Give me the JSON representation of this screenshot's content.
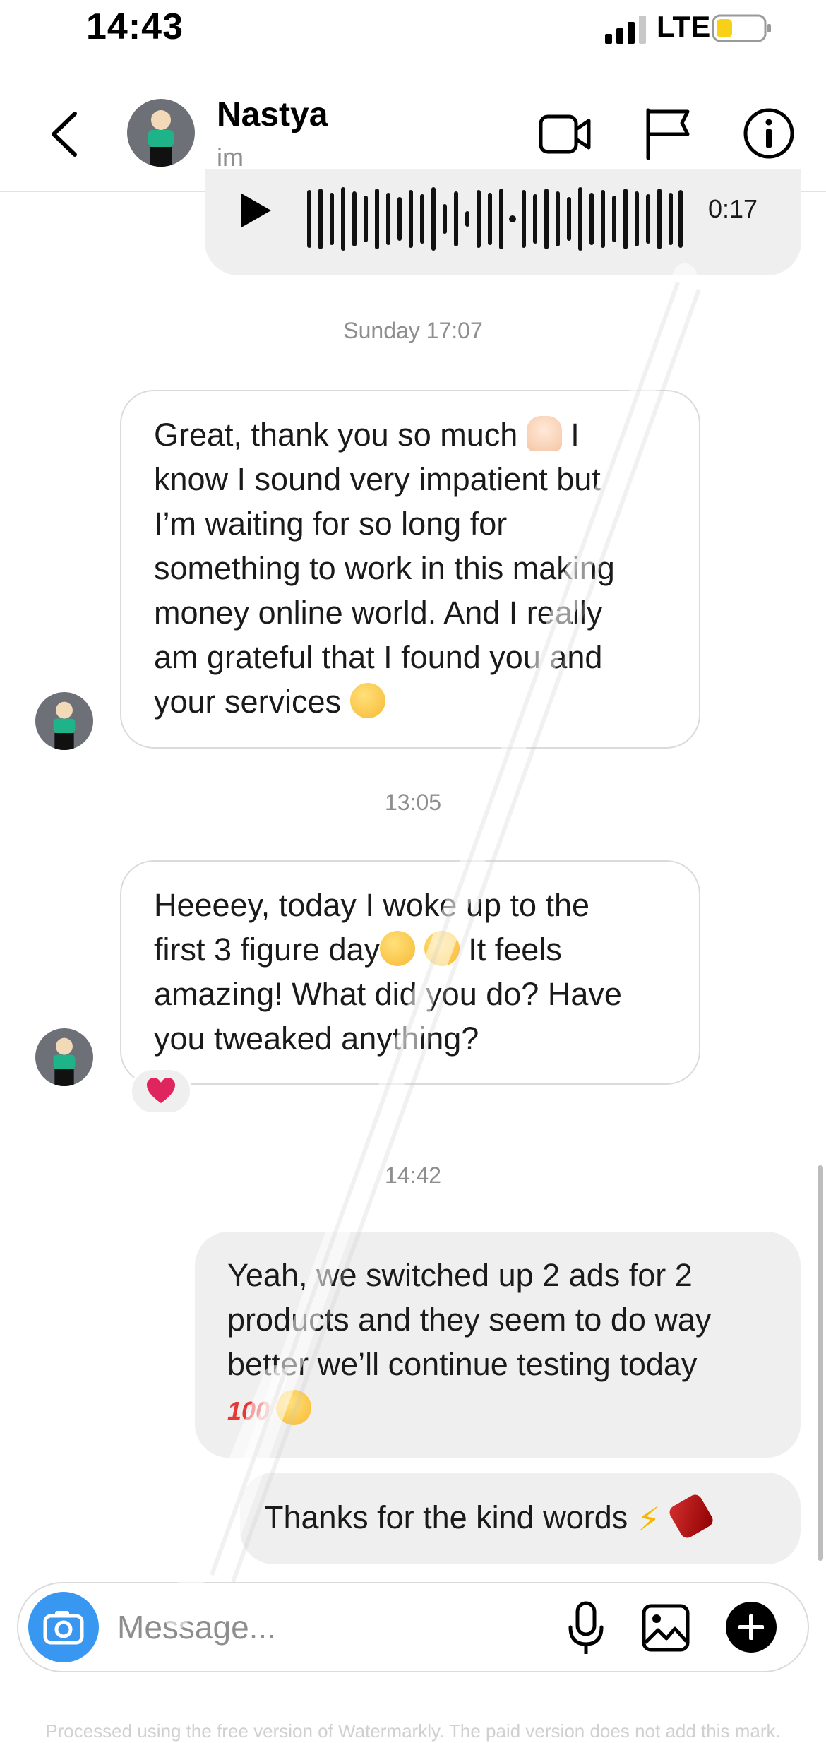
{
  "status_bar": {
    "time": "14:43",
    "network": "LTE"
  },
  "header": {
    "contact_name": "Nastya",
    "contact_subtitle": "im"
  },
  "voice_message": {
    "duration": "0:17"
  },
  "messages": [
    {
      "timestamp": "Sunday 17:07",
      "text_lines": [
        "Great, thank you so much",
        "know I sound very impatient but",
        "I’m waiting for so long for",
        "something to work in this making",
        "money online world. And I really",
        "am grateful that I found you and",
        "your services"
      ]
    },
    {
      "timestamp": "13:05",
      "text_lines": [
        "Heeeey, today I woke up to the",
        "first 3 figure day",
        "It feels",
        "amazing! What did you do? Have",
        "you tweaked anything?"
      ]
    },
    {
      "timestamp": "14:42",
      "text_lines": [
        "Yeah, we switched up 2 ads for 2",
        "products and they seem to do way",
        "better we’ll continue testing today"
      ]
    },
    {
      "text": "Thanks for the kind words"
    }
  ],
  "composer": {
    "placeholder": "Message..."
  },
  "footer": {
    "watermark_text": "Processed using the free version of Watermarkly. The paid version does not add this mark."
  },
  "colors": {
    "accent": "#3897f0",
    "bubble_out": "#efefef",
    "heart": "#e0245e"
  },
  "icons": [
    "back-icon",
    "video-call-icon",
    "flag-icon",
    "info-icon",
    "play-icon",
    "camera-icon",
    "microphone-icon",
    "gallery-icon",
    "plus-icon",
    "heart-reaction-icon"
  ]
}
